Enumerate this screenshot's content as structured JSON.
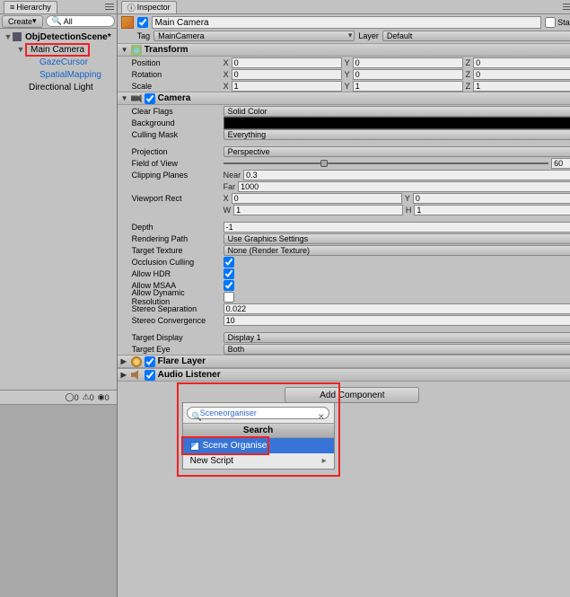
{
  "hierarchy": {
    "tab": "Hierarchy",
    "create": "Create",
    "search_prefix": "All",
    "scene": "ObjDetectionScene*",
    "items": [
      "Main Camera",
      "GazeCursor",
      "SpatialMapping",
      "Directional Light"
    ],
    "stats": [
      "0",
      "0",
      "0"
    ]
  },
  "inspector": {
    "tab": "Inspector",
    "name": "Main Camera",
    "static": "Static",
    "tag_label": "Tag",
    "tag": "MainCamera",
    "layer_label": "Layer",
    "layer": "Default",
    "transform": {
      "title": "Transform",
      "rows": [
        {
          "label": "Position",
          "x": "0",
          "y": "0",
          "z": "0"
        },
        {
          "label": "Rotation",
          "x": "0",
          "y": "0",
          "z": "0"
        },
        {
          "label": "Scale",
          "x": "1",
          "y": "1",
          "z": "1"
        }
      ]
    },
    "camera": {
      "title": "Camera",
      "clear_flags_label": "Clear Flags",
      "clear_flags": "Solid Color",
      "background_label": "Background",
      "background": "#000000",
      "culling_mask_label": "Culling Mask",
      "culling_mask": "Everything",
      "projection_label": "Projection",
      "projection": "Perspective",
      "fov_label": "Field of View",
      "fov": "60",
      "clipping_label": "Clipping Planes",
      "near_label": "Near",
      "near": "0.3",
      "far_label": "Far",
      "far": "1000",
      "viewport_label": "Viewport Rect",
      "vx": "0",
      "vy": "0",
      "vw": "1",
      "vh": "1",
      "depth_label": "Depth",
      "depth": "-1",
      "rendering_path_label": "Rendering Path",
      "rendering_path": "Use Graphics Settings",
      "target_texture_label": "Target Texture",
      "target_texture": "None (Render Texture)",
      "occlusion_label": "Occlusion Culling",
      "hdr_label": "Allow HDR",
      "msaa_label": "Allow MSAA",
      "dynres_label": "Allow Dynamic Resolution",
      "stereo_sep_label": "Stereo Separation",
      "stereo_sep": "0.022",
      "stereo_conv_label": "Stereo Convergence",
      "stereo_conv": "10",
      "target_display_label": "Target Display",
      "target_display": "Display 1",
      "target_eye_label": "Target Eye",
      "target_eye": "Both"
    },
    "flare": {
      "title": "Flare Layer"
    },
    "audio": {
      "title": "Audio Listener"
    },
    "add_component": "Add Component",
    "popup": {
      "search": "Sceneorganiser",
      "title": "Search",
      "items": [
        "Scene Organiser",
        "New Script"
      ]
    }
  }
}
